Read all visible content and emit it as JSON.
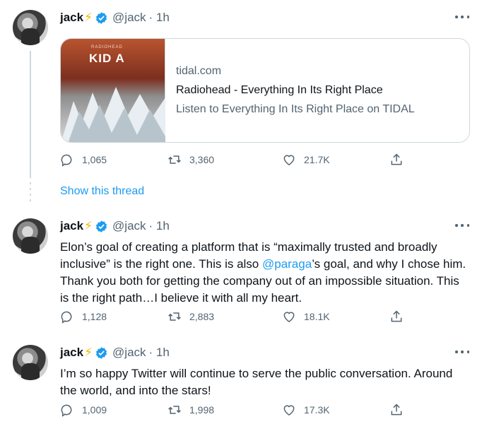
{
  "tweets": [
    {
      "name": "jack",
      "handle": "@jack",
      "time": "· 1h",
      "card": {
        "album_label": "RADIOHEAD",
        "album_title": "KID A",
        "domain": "tidal.com",
        "title": "Radiohead - Everything In Its Right Place",
        "description": "Listen to Everything In Its Right Place on TIDAL"
      },
      "replies": "1,065",
      "retweets": "3,360",
      "likes": "21.7K"
    },
    {
      "name": "jack",
      "handle": "@jack",
      "time": "· 1h",
      "text_before": "Elon’s goal of creating a platform that is “maximally trusted and broadly inclusive” is the right one. This is also ",
      "mention": "@paraga",
      "text_after": "’s goal, and why I chose him. Thank you both for getting the company out of an impossible situation. This is the right path…I believe it with all my heart.",
      "replies": "1,128",
      "retweets": "2,883",
      "likes": "18.1K"
    },
    {
      "name": "jack",
      "handle": "@jack",
      "time": "· 1h",
      "text": "I’m so happy Twitter will continue to serve the public conversation. Around the world, and into the stars!",
      "replies": "1,009",
      "retweets": "1,998",
      "likes": "17.3K"
    }
  ],
  "show_thread_label": "Show this thread",
  "bolt": "⚡",
  "colors": {
    "accent": "#1d9bf0",
    "muted": "#536471",
    "border": "#cfd9de",
    "bolt": "#f7b500"
  },
  "icons": [
    "avatar",
    "lightning-bolt-icon",
    "verified-badge-icon",
    "more-options-icon",
    "reply-icon",
    "retweet-icon",
    "like-icon",
    "share-icon"
  ]
}
